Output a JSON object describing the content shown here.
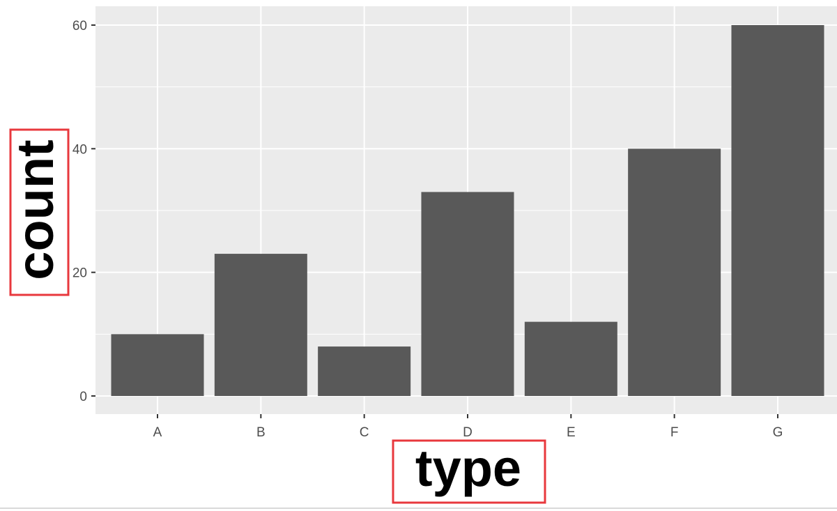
{
  "chart_data": {
    "type": "bar",
    "title": "",
    "xlabel": "type",
    "ylabel": "count",
    "categories": [
      "A",
      "B",
      "C",
      "D",
      "E",
      "F",
      "G"
    ],
    "values": [
      10,
      23,
      8,
      33,
      12,
      40,
      60
    ],
    "ylim": [
      0,
      63
    ],
    "yticks": [
      0,
      20,
      40,
      60
    ],
    "grid": true,
    "legend": "none",
    "colors": {
      "bar": "#595959",
      "panel": "#ebebeb",
      "grid": "#ffffff",
      "highlight_box": "#e8383d",
      "tick_text": "#4d4d4d"
    },
    "annotations": [
      "x-axis title boxed in red",
      "y-axis title boxed in red"
    ]
  }
}
